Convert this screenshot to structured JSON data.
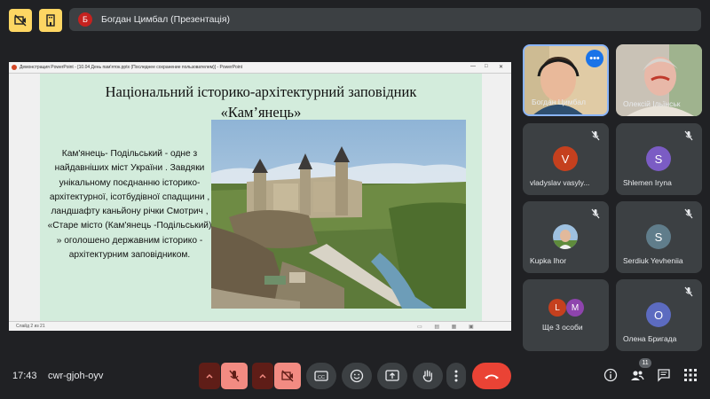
{
  "banner": {
    "avatar_letter": "Б",
    "presenter": "Богдан Цимбал (Презентація)"
  },
  "ppt": {
    "window_title": "Демонстрация PowerPoint - [10.04 День пам'яток.pptx (Последнее сохранение пользователем)] - PowerPoint",
    "status": "Слайд 2 из 21"
  },
  "slide": {
    "title_line1": "Національний історико-архітектурний заповідник",
    "title_line2": "«Кам’янець»",
    "body": "Кам'янець- Подільський - одне з найдавніших міст України . Завдяки унікальному поєднанню історико-архітектурної, ісотбудівної спадщини , ландшафту каньйону річки Смотрич , «Старе місто (Кам'янець -Подільський) » оголошено державним історико - архітектурним заповідником."
  },
  "participants": [
    {
      "name": "Богдан Цимбал",
      "type": "video"
    },
    {
      "name": "Олексій Ільїнськ",
      "type": "video"
    },
    {
      "name": "vladyslav vasyly...",
      "letter": "V",
      "color": "#c5401e",
      "muted": true
    },
    {
      "name": "Shlemen Iryna",
      "letter": "S",
      "color": "#7b5cc4",
      "muted": true
    },
    {
      "name": "Kupka Ihor",
      "type": "photo",
      "muted": true
    },
    {
      "name": "Serdiuk Yevheniia",
      "letter": "S",
      "color": "#607d8b",
      "muted": true
    },
    {
      "name": "Ще 3 особи",
      "letters": [
        "L",
        "M"
      ],
      "colors": [
        "#c5401e",
        "#8e44ad"
      ]
    },
    {
      "name": "Олена Бригада",
      "letter": "O",
      "color": "#5c6bc0",
      "muted": true
    }
  ],
  "footer": {
    "time": "17:43",
    "meeting_code": "cwr-gjoh-oyv",
    "people_count": "11"
  },
  "colors": {
    "background": "#202124",
    "tile": "#3c4043",
    "end_call": "#ea4335",
    "muted": "#f28b82",
    "top_icons": "#fdd663",
    "slide_bg": "#d3ecdc"
  },
  "icons": [
    "layout-icon",
    "info-icon",
    "people-icon",
    "chat-icon",
    "activities-icon",
    "mic-off-icon",
    "camera-off-icon",
    "captions-icon",
    "emoji-icon",
    "present-icon",
    "raise-hand-icon",
    "more-icon",
    "end-call-icon"
  ]
}
